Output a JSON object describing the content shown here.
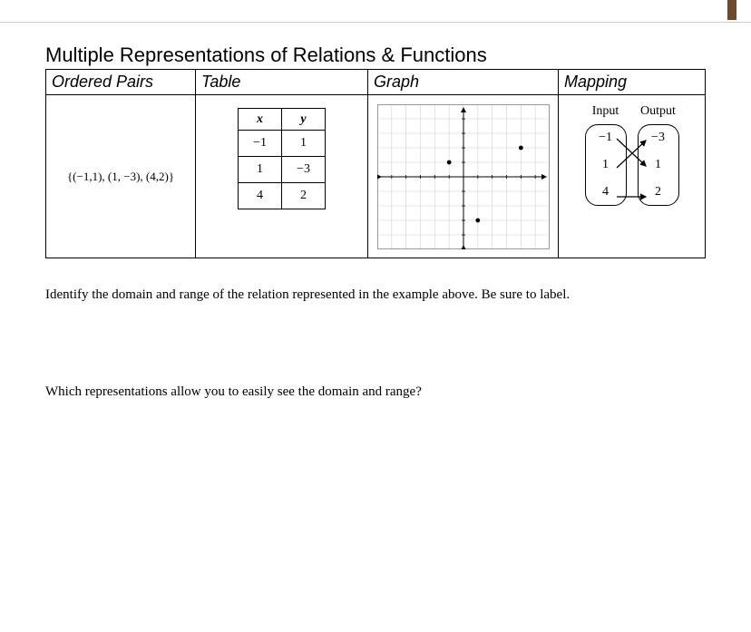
{
  "title": "Multiple Representations of Relations & Functions",
  "headers": {
    "ordered_pairs": "Ordered Pairs",
    "table": "Table",
    "graph": "Graph",
    "mapping": "Mapping"
  },
  "ordered_pairs_text": "{(−1,1), (1, −3), (4,2)}",
  "xy_table": {
    "head_x": "x",
    "head_y": "y",
    "rows": [
      {
        "x": "−1",
        "y": "1"
      },
      {
        "x": "1",
        "y": "−3"
      },
      {
        "x": "4",
        "y": "2"
      }
    ]
  },
  "mapping": {
    "input_label": "Input",
    "output_label": "Output",
    "inputs": [
      "−1",
      "1",
      "4"
    ],
    "outputs": [
      "−3",
      "1",
      "2"
    ]
  },
  "chart_data": {
    "type": "scatter",
    "title": "",
    "xlabel": "",
    "ylabel": "",
    "xlim": [
      -6,
      6
    ],
    "ylim": [
      -5,
      5
    ],
    "series": [
      {
        "name": "points",
        "x": [
          -1,
          1,
          4
        ],
        "y": [
          1,
          -3,
          2
        ]
      }
    ]
  },
  "question1": "Identify the domain and range of the relation represented in the example above. Be sure to label.",
  "question2": "Which representations allow you to easily see the domain and range?"
}
